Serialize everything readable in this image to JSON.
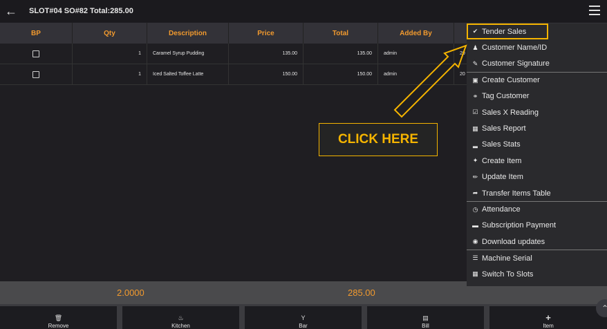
{
  "topbar": {
    "back_icon": "arrow-left-icon",
    "title": "SLOT#04 SO#82 Total:285.00",
    "menu_icon": "hamburger-icon"
  },
  "table": {
    "headers": [
      "BP",
      "Qty",
      "Description",
      "Price",
      "Total",
      "Added By"
    ],
    "rows": [
      {
        "qty": "1",
        "description": "Caramel Syrup Pudding",
        "price": "135.00",
        "total": "135.00",
        "added_by": "admin",
        "extra": "20"
      },
      {
        "qty": "1",
        "description": "Iced Salted Toffee Latte",
        "price": "150.00",
        "total": "150.00",
        "added_by": "admin",
        "extra": "20"
      }
    ]
  },
  "totals": {
    "qty_total": "2.0000",
    "amount_total": "285.00"
  },
  "buttons": [
    {
      "label": "Remove",
      "icon": "trash-icon"
    },
    {
      "label": "Kitchen",
      "icon": "chef-icon"
    },
    {
      "label": "Bar",
      "icon": "cocktail-icon"
    },
    {
      "label": "Bill",
      "icon": "receipt-icon"
    },
    {
      "label": "Item",
      "icon": "plus-icon"
    }
  ],
  "menu": {
    "items": [
      {
        "label": "Tender Sales",
        "icon": "check-icon"
      },
      {
        "label": "Customer Name/ID",
        "icon": "user-icon"
      },
      {
        "label": "Customer Signature",
        "icon": "signature-icon"
      },
      {
        "label": "Create Customer",
        "icon": "id-card-icon"
      },
      {
        "label": "Tag Customer",
        "icon": "tag-icon"
      },
      {
        "label": "Sales X Reading",
        "icon": "clipboard-check-icon"
      },
      {
        "label": "Sales Report",
        "icon": "report-icon"
      },
      {
        "label": "Sales Stats",
        "icon": "bar-chart-icon"
      },
      {
        "label": "Create Item",
        "icon": "magic-wand-icon"
      },
      {
        "label": "Update Item",
        "icon": "pencil-icon"
      },
      {
        "label": "Transfer Items Table",
        "icon": "share-icon"
      },
      {
        "label": "Attendance",
        "icon": "clock-icon"
      },
      {
        "label": "Subscription Payment",
        "icon": "credit-card-icon"
      },
      {
        "label": "Download updates",
        "icon": "globe-icon"
      },
      {
        "label": "Machine Serial",
        "icon": "barcode-icon"
      },
      {
        "label": "Switch To Slots",
        "icon": "grid-icon"
      }
    ]
  },
  "callout": {
    "text": "CLICK HERE"
  },
  "colors": {
    "accent": "#f29a2e",
    "highlight": "#f5b400",
    "background": "#1f1e22"
  }
}
